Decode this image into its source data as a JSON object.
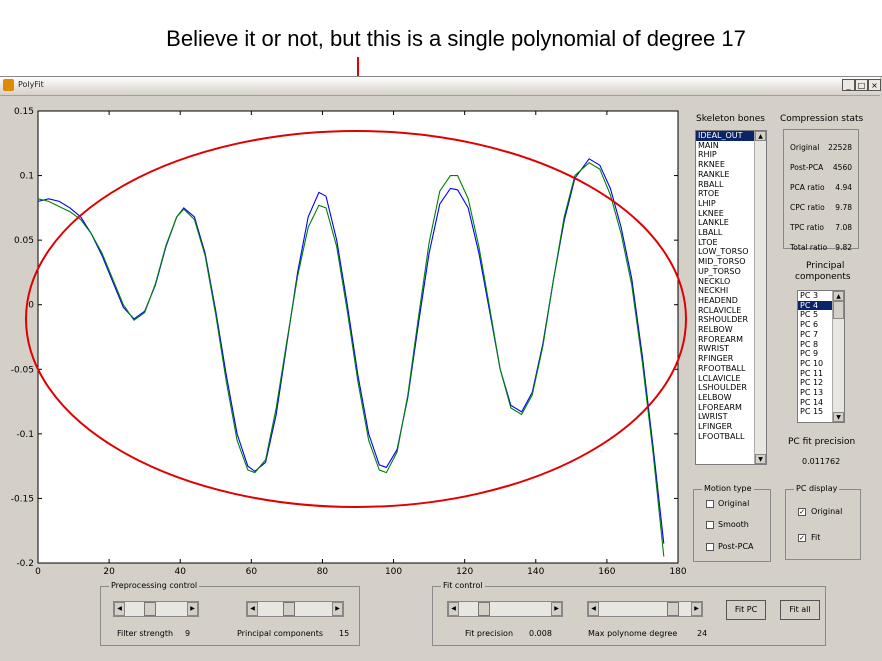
{
  "annotation": "Believe it or not, but this is a single polynomial of degree 17",
  "window": {
    "title": "PolyFit",
    "minimize_glyph": "_",
    "maximize_glyph": "□",
    "close_glyph": "×"
  },
  "colors": {
    "original_series": "#0000ff",
    "fit_series": "#008000",
    "ellipse": "#e00000",
    "selection": "#0a246a",
    "face": "#d4d0c8"
  },
  "chart_data": {
    "type": "line",
    "xlim": [
      0,
      180
    ],
    "ylim": [
      -0.2,
      0.15
    ],
    "xticks": [
      "0",
      "20",
      "40",
      "60",
      "80",
      "100",
      "120",
      "140",
      "160",
      "180"
    ],
    "yticks": [
      "0.15",
      "0.1",
      "0.05",
      "0",
      "-0.05",
      "-0.1",
      "-0.15",
      "-0.2"
    ],
    "series": [
      {
        "color": "#0000ff",
        "points": [
          [
            0,
            0.08
          ],
          [
            3,
            0.082
          ],
          [
            6,
            0.08
          ],
          [
            9,
            0.075
          ],
          [
            12,
            0.068
          ],
          [
            15,
            0.055
          ],
          [
            18,
            0.038
          ],
          [
            21,
            0.018
          ],
          [
            24,
            -0.002
          ],
          [
            27,
            -0.011
          ],
          [
            30,
            -0.005
          ],
          [
            33,
            0.015
          ],
          [
            36,
            0.045
          ],
          [
            39,
            0.068
          ],
          [
            41,
            0.075
          ],
          [
            44,
            0.068
          ],
          [
            47,
            0.04
          ],
          [
            50,
            -0.005
          ],
          [
            53,
            -0.055
          ],
          [
            56,
            -0.1
          ],
          [
            59,
            -0.125
          ],
          [
            61,
            -0.129
          ],
          [
            64,
            -0.122
          ],
          [
            67,
            -0.085
          ],
          [
            70,
            -0.03
          ],
          [
            73,
            0.025
          ],
          [
            76,
            0.068
          ],
          [
            79,
            0.087
          ],
          [
            81,
            0.084
          ],
          [
            84,
            0.05
          ],
          [
            87,
            0.0
          ],
          [
            90,
            -0.055
          ],
          [
            93,
            -0.1
          ],
          [
            96,
            -0.124
          ],
          [
            98,
            -0.126
          ],
          [
            101,
            -0.112
          ],
          [
            104,
            -0.072
          ],
          [
            107,
            -0.015
          ],
          [
            110,
            0.04
          ],
          [
            113,
            0.078
          ],
          [
            116,
            0.09
          ],
          [
            118,
            0.089
          ],
          [
            121,
            0.075
          ],
          [
            124,
            0.04
          ],
          [
            127,
            -0.005
          ],
          [
            130,
            -0.05
          ],
          [
            133,
            -0.078
          ],
          [
            136,
            -0.083
          ],
          [
            139,
            -0.068
          ],
          [
            142,
            -0.03
          ],
          [
            145,
            0.02
          ],
          [
            148,
            0.065
          ],
          [
            151,
            0.098
          ],
          [
            155,
            0.113
          ],
          [
            158,
            0.108
          ],
          [
            161,
            0.09
          ],
          [
            164,
            0.06
          ],
          [
            167,
            0.02
          ],
          [
            170,
            -0.04
          ],
          [
            173,
            -0.11
          ],
          [
            176,
            -0.185
          ]
        ]
      },
      {
        "color": "#008000",
        "points": [
          [
            0,
            0.082
          ],
          [
            3,
            0.08
          ],
          [
            6,
            0.076
          ],
          [
            9,
            0.072
          ],
          [
            12,
            0.066
          ],
          [
            15,
            0.055
          ],
          [
            18,
            0.04
          ],
          [
            21,
            0.02
          ],
          [
            24,
            0.0
          ],
          [
            27,
            -0.012
          ],
          [
            30,
            -0.006
          ],
          [
            33,
            0.016
          ],
          [
            36,
            0.046
          ],
          [
            39,
            0.068
          ],
          [
            41,
            0.074
          ],
          [
            44,
            0.066
          ],
          [
            47,
            0.038
          ],
          [
            50,
            -0.008
          ],
          [
            53,
            -0.06
          ],
          [
            56,
            -0.105
          ],
          [
            59,
            -0.128
          ],
          [
            61,
            -0.13
          ],
          [
            64,
            -0.12
          ],
          [
            67,
            -0.08
          ],
          [
            70,
            -0.028
          ],
          [
            73,
            0.022
          ],
          [
            76,
            0.06
          ],
          [
            79,
            0.077
          ],
          [
            81,
            0.075
          ],
          [
            84,
            0.045
          ],
          [
            87,
            -0.005
          ],
          [
            90,
            -0.06
          ],
          [
            93,
            -0.105
          ],
          [
            96,
            -0.128
          ],
          [
            98,
            -0.13
          ],
          [
            101,
            -0.114
          ],
          [
            104,
            -0.07
          ],
          [
            107,
            -0.01
          ],
          [
            110,
            0.048
          ],
          [
            113,
            0.088
          ],
          [
            116,
            0.1
          ],
          [
            118,
            0.1
          ],
          [
            121,
            0.082
          ],
          [
            124,
            0.045
          ],
          [
            127,
            -0.002
          ],
          [
            130,
            -0.05
          ],
          [
            133,
            -0.08
          ],
          [
            136,
            -0.085
          ],
          [
            139,
            -0.07
          ],
          [
            142,
            -0.032
          ],
          [
            145,
            0.02
          ],
          [
            148,
            0.068
          ],
          [
            151,
            0.1
          ],
          [
            155,
            0.11
          ],
          [
            158,
            0.105
          ],
          [
            161,
            0.085
          ],
          [
            164,
            0.055
          ],
          [
            167,
            0.015
          ],
          [
            170,
            -0.045
          ],
          [
            173,
            -0.115
          ],
          [
            176,
            -0.195
          ]
        ]
      }
    ]
  },
  "skeleton_bones": {
    "title": "Skeleton bones",
    "items": [
      "IDEAL_OUT",
      "MAIN",
      "RHIP",
      "RKNEE",
      "RANKLE",
      "RBALL",
      "RTOE",
      "LHIP",
      "LKNEE",
      "LANKLE",
      "LBALL",
      "LTOE",
      "LOW_TORSO",
      "MID_TORSO",
      "UP_TORSO",
      "NECKLO",
      "NECKHI",
      "HEADEND",
      "RCLAVICLE",
      "RSHOULDER",
      "RELBOW",
      "RFOREARM",
      "RWRIST",
      "RFINGER",
      "RFOOTBALL",
      "LCLAVICLE",
      "LSHOULDER",
      "LELBOW",
      "LFOREARM",
      "LWRIST",
      "LFINGER",
      "LFOOTBALL"
    ],
    "selected_index": 0
  },
  "compression_stats": {
    "title": "Compression stats",
    "rows": [
      {
        "label": "Original",
        "value": "22528"
      },
      {
        "label": "Post-PCA",
        "value": "4560"
      },
      {
        "label": "PCA ratio",
        "value": "4.94"
      },
      {
        "label": "CPC ratio",
        "value": "9.78"
      },
      {
        "label": "TPC ratio",
        "value": "7.08"
      },
      {
        "label": "Total ratio",
        "value": "9.82"
      }
    ]
  },
  "principal_components": {
    "title_line1": "Principal",
    "title_line2": "components",
    "items": [
      "PC 3",
      "PC 4",
      "PC 5",
      "PC 6",
      "PC 7",
      "PC 8",
      "PC 9",
      "PC 10",
      "PC 11",
      "PC 12",
      "PC 13",
      "PC 14",
      "PC 15"
    ],
    "selected_index": 1
  },
  "pc_fit": {
    "label": "PC fit precision",
    "value": "0.011762"
  },
  "motion_type": {
    "title": "Motion type",
    "options": [
      {
        "label": "Original",
        "checked": false
      },
      {
        "label": "Smooth",
        "checked": false
      },
      {
        "label": "Post-PCA",
        "checked": false
      }
    ]
  },
  "pc_display": {
    "title": "PC display",
    "options": [
      {
        "label": "Original",
        "checked": true
      },
      {
        "label": "Fit",
        "checked": true
      }
    ]
  },
  "preprocessing": {
    "title": "Preprocessing control",
    "filter_label": "Filter strength",
    "filter_value": "9",
    "pc_label": "Principal components",
    "pc_value": "15"
  },
  "fit_control": {
    "title": "Fit control",
    "precision_label": "Fit precision",
    "precision_value": "0.008",
    "degree_label": "Max polynome degree",
    "degree_value": "24",
    "fit_pc_button": "Fit PC",
    "fit_all_button": "Fit all"
  }
}
